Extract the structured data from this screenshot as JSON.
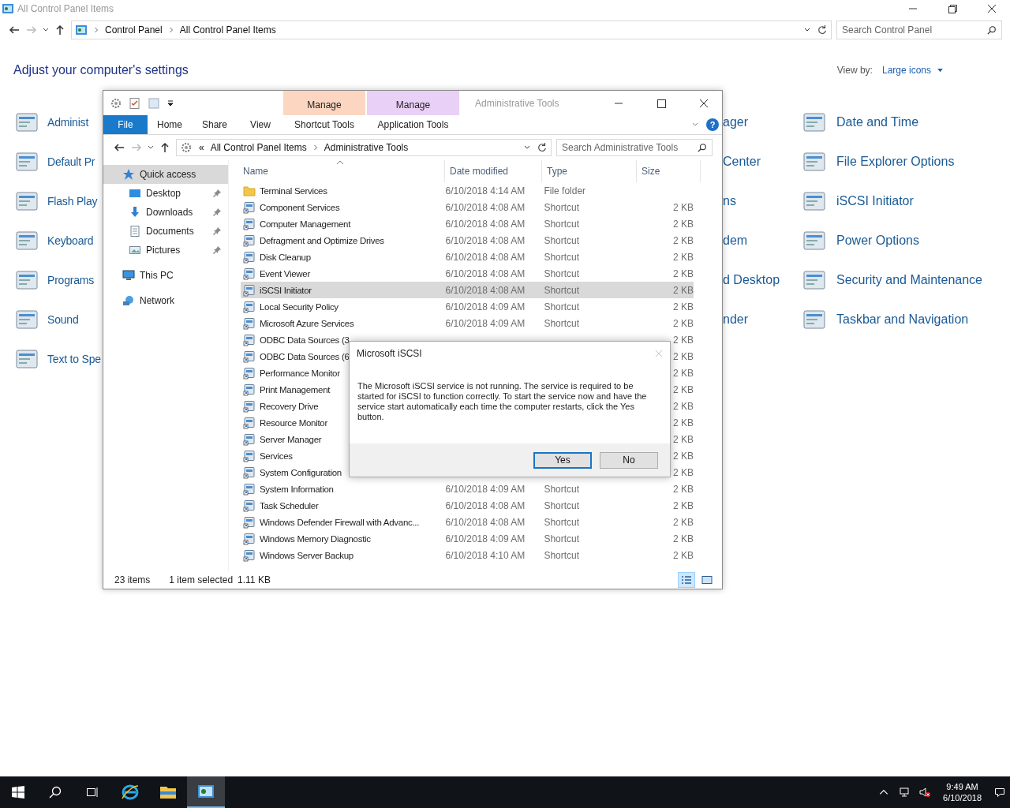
{
  "control_panel": {
    "title": "All Control Panel Items",
    "breadcrumb": [
      "Control Panel",
      "All Control Panel Items"
    ],
    "search": {
      "placeholder": "Search Control Panel"
    },
    "heading": "Adjust your computer's settings",
    "view_by": {
      "label": "View by:",
      "value": "Large icons"
    },
    "left_column": [
      {
        "label": "Administ"
      },
      {
        "label": "Default Pr"
      },
      {
        "label": "Flash Play"
      },
      {
        "label": "Keyboard"
      },
      {
        "label": "Programs"
      },
      {
        "label": "Sound"
      },
      {
        "label": "Text to Spe"
      }
    ],
    "middle_column": [
      {
        "label": "ager"
      },
      {
        "label": "Center"
      },
      {
        "label": "ns"
      },
      {
        "label": "dem"
      },
      {
        "label": "d Desktop"
      },
      {
        "label": "nder"
      }
    ],
    "right_column": [
      {
        "label": "Date and Time"
      },
      {
        "label": "File Explorer Options"
      },
      {
        "label": "iSCSI Initiator"
      },
      {
        "label": "Power Options"
      },
      {
        "label": "Security and Maintenance"
      },
      {
        "label": "Taskbar and Navigation"
      }
    ]
  },
  "explorer": {
    "title": "Administrative Tools",
    "help": "?",
    "ribbon_tabs": [
      {
        "label": "File",
        "selected": true
      },
      {
        "label": "Home",
        "selected": false
      },
      {
        "label": "Share",
        "selected": false
      },
      {
        "label": "View",
        "selected": false
      },
      {
        "label": "Shortcut Tools",
        "selected": false,
        "group": "Manage",
        "color": "#fdd6c2"
      },
      {
        "label": "Application Tools",
        "selected": false,
        "group": "Manage",
        "color": "#e9d0f7"
      }
    ],
    "address": {
      "overflow": "«",
      "path": [
        "All Control Panel Items",
        "Administrative Tools"
      ]
    },
    "search": {
      "placeholder": "Search Administrative Tools"
    },
    "nav": [
      {
        "label": "Quick access",
        "kind": "quick",
        "selected": true
      },
      {
        "label": "Desktop",
        "kind": "desktop",
        "selected": false,
        "pinned": true
      },
      {
        "label": "Downloads",
        "kind": "downloads",
        "selected": false,
        "pinned": true
      },
      {
        "label": "Documents",
        "kind": "documents",
        "selected": false,
        "pinned": true
      },
      {
        "label": "Pictures",
        "kind": "pictures",
        "selected": false,
        "pinned": true
      },
      {
        "label": "This PC",
        "kind": "pc",
        "selected": false
      },
      {
        "label": "Network",
        "kind": "network",
        "selected": false
      }
    ],
    "columns": [
      "Name",
      "Date modified",
      "Type",
      "Size"
    ],
    "files": [
      {
        "name": "Terminal Services",
        "date": "6/10/2018 4:14 AM",
        "type": "File folder",
        "kind": "folder",
        "selected": false
      },
      {
        "name": "Component Services",
        "date": "6/10/2018 4:08 AM",
        "type": "Shortcut",
        "size": "2 KB",
        "kind": "shortcut",
        "selected": false
      },
      {
        "name": "Computer Management",
        "date": "6/10/2018 4:08 AM",
        "type": "Shortcut",
        "size": "2 KB",
        "kind": "shortcut",
        "selected": false
      },
      {
        "name": "Defragment and Optimize Drives",
        "date": "6/10/2018 4:08 AM",
        "type": "Shortcut",
        "size": "2 KB",
        "kind": "shortcut",
        "selected": false
      },
      {
        "name": "Disk Cleanup",
        "date": "6/10/2018 4:08 AM",
        "type": "Shortcut",
        "size": "2 KB",
        "kind": "shortcut",
        "selected": false
      },
      {
        "name": "Event Viewer",
        "date": "6/10/2018 4:08 AM",
        "type": "Shortcut",
        "size": "2 KB",
        "kind": "shortcut",
        "selected": false
      },
      {
        "name": "iSCSI Initiator",
        "date": "6/10/2018 4:08 AM",
        "type": "Shortcut",
        "size": "2 KB",
        "kind": "shortcut",
        "selected": true
      },
      {
        "name": "Local Security Policy",
        "date": "6/10/2018 4:09 AM",
        "type": "Shortcut",
        "size": "2 KB",
        "kind": "shortcut",
        "selected": false
      },
      {
        "name": "Microsoft Azure Services",
        "date": "6/10/2018 4:09 AM",
        "type": "Shortcut",
        "size": "2 KB",
        "kind": "shortcut",
        "selected": false
      },
      {
        "name": "ODBC Data Sources (3",
        "size": "2 KB",
        "kind": "shortcut",
        "selected": false
      },
      {
        "name": "ODBC Data Sources (6",
        "size": "2 KB",
        "kind": "shortcut",
        "selected": false
      },
      {
        "name": "Performance Monitor",
        "size": "2 KB",
        "kind": "shortcut",
        "selected": false
      },
      {
        "name": "Print Management",
        "size": "2 KB",
        "kind": "shortcut",
        "selected": false
      },
      {
        "name": "Recovery Drive",
        "size": "2 KB",
        "kind": "shortcut",
        "selected": false
      },
      {
        "name": "Resource Monitor",
        "size": "2 KB",
        "kind": "shortcut",
        "selected": false
      },
      {
        "name": "Server Manager",
        "size": "2 KB",
        "kind": "shortcut",
        "selected": false
      },
      {
        "name": "Services",
        "size": "2 KB",
        "kind": "shortcut",
        "selected": false
      },
      {
        "name": "System Configuration",
        "size": "2 KB",
        "kind": "shortcut",
        "selected": false
      },
      {
        "name": "System Information",
        "date": "6/10/2018 4:09 AM",
        "type": "Shortcut",
        "size": "2 KB",
        "kind": "shortcut",
        "selected": false
      },
      {
        "name": "Task Scheduler",
        "date": "6/10/2018 4:08 AM",
        "type": "Shortcut",
        "size": "2 KB",
        "kind": "shortcut",
        "selected": false
      },
      {
        "name": "Windows Defender Firewall with Advanc...",
        "date": "6/10/2018 4:08 AM",
        "type": "Shortcut",
        "size": "2 KB",
        "kind": "shortcut",
        "selected": false
      },
      {
        "name": "Windows Memory Diagnostic",
        "date": "6/10/2018 4:09 AM",
        "type": "Shortcut",
        "size": "2 KB",
        "kind": "shortcut",
        "selected": false
      },
      {
        "name": "Windows Server Backup",
        "date": "6/10/2018 4:10 AM",
        "type": "Shortcut",
        "size": "2 KB",
        "kind": "shortcut",
        "selected": false
      }
    ],
    "status": {
      "count": "23 items",
      "selection": "1 item selected",
      "size": "1.11 KB"
    },
    "views": [
      {
        "kind": "details",
        "selected": true
      },
      {
        "kind": "large",
        "selected": false
      }
    ]
  },
  "dialog": {
    "title": "Microsoft iSCSI",
    "message": "The Microsoft iSCSI service is not running. The service is required to be started for iSCSI to function correctly. To start the service now and have the service start automatically each time the computer restarts, click the Yes button.",
    "buttons": [
      {
        "label": "Yes",
        "default": true
      },
      {
        "label": "No",
        "default": false
      }
    ]
  },
  "taskbar": {
    "time": "9:49 AM",
    "date": "6/10/2018",
    "apps": [
      {
        "kind": "ie",
        "selected": false
      },
      {
        "kind": "explorer",
        "selected": false
      },
      {
        "kind": "control",
        "selected": true
      }
    ]
  }
}
